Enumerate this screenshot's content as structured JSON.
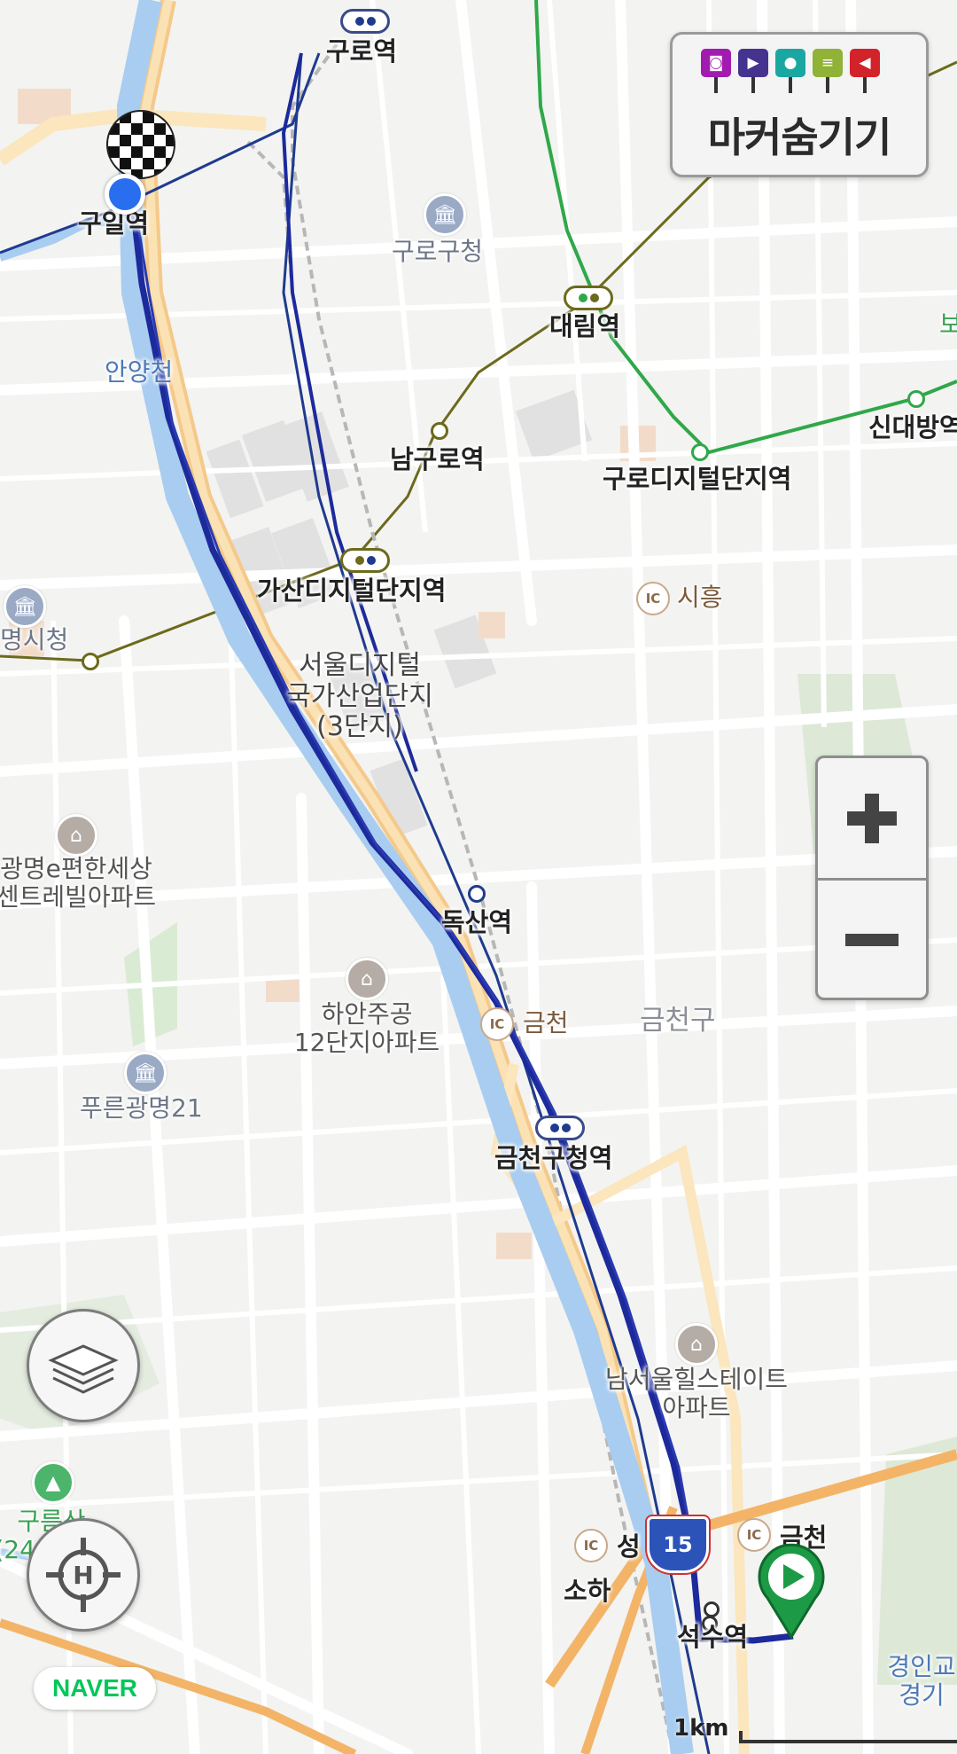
{
  "marker_panel": {
    "title": "마커숨기기",
    "icons": [
      {
        "name": "camera-icon",
        "color": "#a21bb0",
        "glyph": "📷"
      },
      {
        "name": "video-icon",
        "color": "#45338f",
        "glyph": "■"
      },
      {
        "name": "microphone-icon",
        "color": "#1aa7a2",
        "glyph": "🎤"
      },
      {
        "name": "memo-icon",
        "color": "#8fb237",
        "glyph": "▤"
      },
      {
        "name": "flag-icon",
        "color": "#d3232a",
        "glyph": "◀"
      }
    ]
  },
  "zoom": {
    "plus": "+",
    "minus": "−"
  },
  "buttons": {
    "layers": "layers-icon",
    "locate": "crosshair-icon"
  },
  "logo": "NAVER",
  "scale": {
    "label": "1km"
  },
  "colors": {
    "route": "#1c2a9c",
    "river": "#a8cdf0",
    "road_major": "#f4c98a",
    "line_green": "#2fa84a",
    "line_olive": "#6c6a1c"
  },
  "labels": {
    "guro_station": "구로역",
    "guil_station": "구일역",
    "guro_office": "구로구청",
    "daerim_station": "대림역",
    "anyangcheon": "안양천",
    "namguro_station": "남구로역",
    "guro_digital": "구로디지털단지역",
    "sindaebang": "신대방역",
    "gasan_digital": "가산디지털단지역",
    "siheung_ic": "시흥",
    "gwangmyeong_city_hall": "명시청",
    "seoul_digital": "서울디지털\n국가산업단지\n(3단지)",
    "gwangmyeong_apt": "광명e편한세상\n센트레빌아파트",
    "doksan_station": "독산역",
    "haan_apt": "하안주공\n12단지아파트",
    "geumcheon_ic": "금천",
    "geumcheon_gu": "금천구",
    "pureun_gm21": "푸른광명21",
    "geumcheon_office_station": "금천구청역",
    "namseoul_apt": "남서울힐스테이트\n아파트",
    "gureumsan": "구름산\n(240.6m)",
    "seong_ic": "성",
    "soha": "소하",
    "seoksu_station": "석수역",
    "geumcheon_ic2": "금천",
    "highway_15": "15",
    "gyeongin": "경인교\n경기",
    "edge_bo": "보"
  }
}
